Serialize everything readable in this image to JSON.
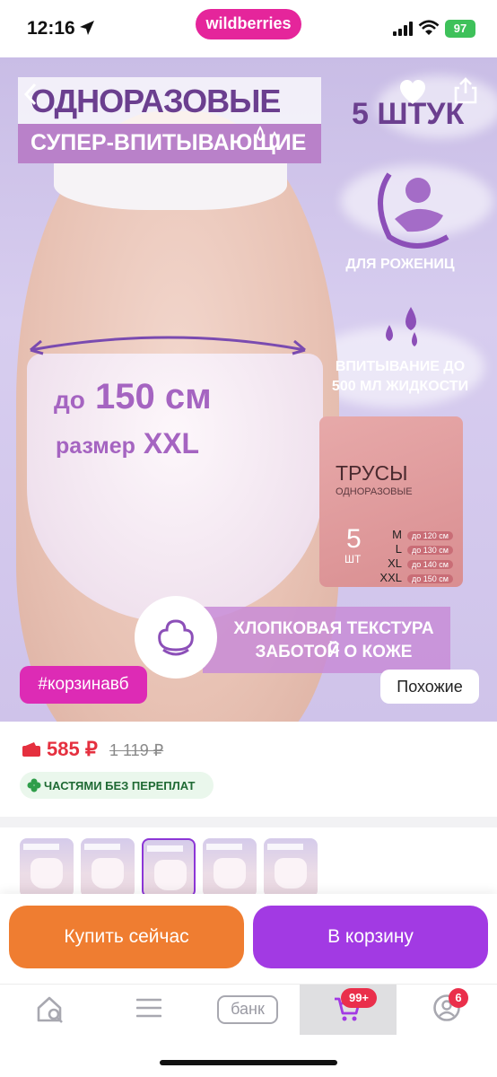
{
  "status_bar": {
    "time": "12:16",
    "brand": "wildberries",
    "battery": "97"
  },
  "hero": {
    "headline": "ОДНОРАЗОВЫЕ ТРУСЫ",
    "subheadline": "СУПЕР-ВПИТЫВАЮЩИЕ",
    "count": "5 ШТУК",
    "feature_mothers": "ДЛЯ РОЖЕНИЦ",
    "feature_absorb_line1": "ВПИТЫВАНИЕ ДО",
    "feature_absorb_line2": "500 МЛ ЖИДКОСТИ",
    "size_prefix": "до",
    "size_value": "150 см",
    "size_label": "размер",
    "size_name": "XXL",
    "package": {
      "title": "ТРУСЫ",
      "subtitle": "ОДНОРАЗОВЫЕ",
      "count": "5",
      "unit": "ШТ",
      "sizes": [
        {
          "size": "M",
          "range": "до 120 см"
        },
        {
          "size": "L",
          "range": "до 130 см"
        },
        {
          "size": "XL",
          "range": "до 140 см"
        },
        {
          "size": "XXL",
          "range": "до 150 см"
        }
      ]
    },
    "cotton_line1": "ХЛОПКОВАЯ ТЕКСТУРА С",
    "cotton_line2": "ЗАБОТОЙ О КОЖЕ",
    "hashtag": "#корзинавб",
    "similar_button": "Похожие"
  },
  "price": {
    "current": "585 ₽",
    "old": "1 119 ₽",
    "installments": "ЧАСТЯМИ БЕЗ ПЕРЕПЛАТ"
  },
  "thumbnails": {
    "selected_index": 2,
    "count": 5
  },
  "actions": {
    "buy_now": "Купить сейчас",
    "add_to_cart": "В корзину"
  },
  "tabbar": {
    "items": [
      {
        "icon": "home-search-icon"
      },
      {
        "icon": "menu-icon"
      },
      {
        "icon": "bank-icon",
        "label": "банк"
      },
      {
        "icon": "cart-icon",
        "badge": "99+"
      },
      {
        "icon": "profile-icon",
        "badge": "6"
      }
    ],
    "active_index": 3
  },
  "colors": {
    "brand": "#e5259b",
    "buy": "#ef7d31",
    "cart": "#a23ae3",
    "price": "#e5303f",
    "accent": "#6b3f8f"
  }
}
